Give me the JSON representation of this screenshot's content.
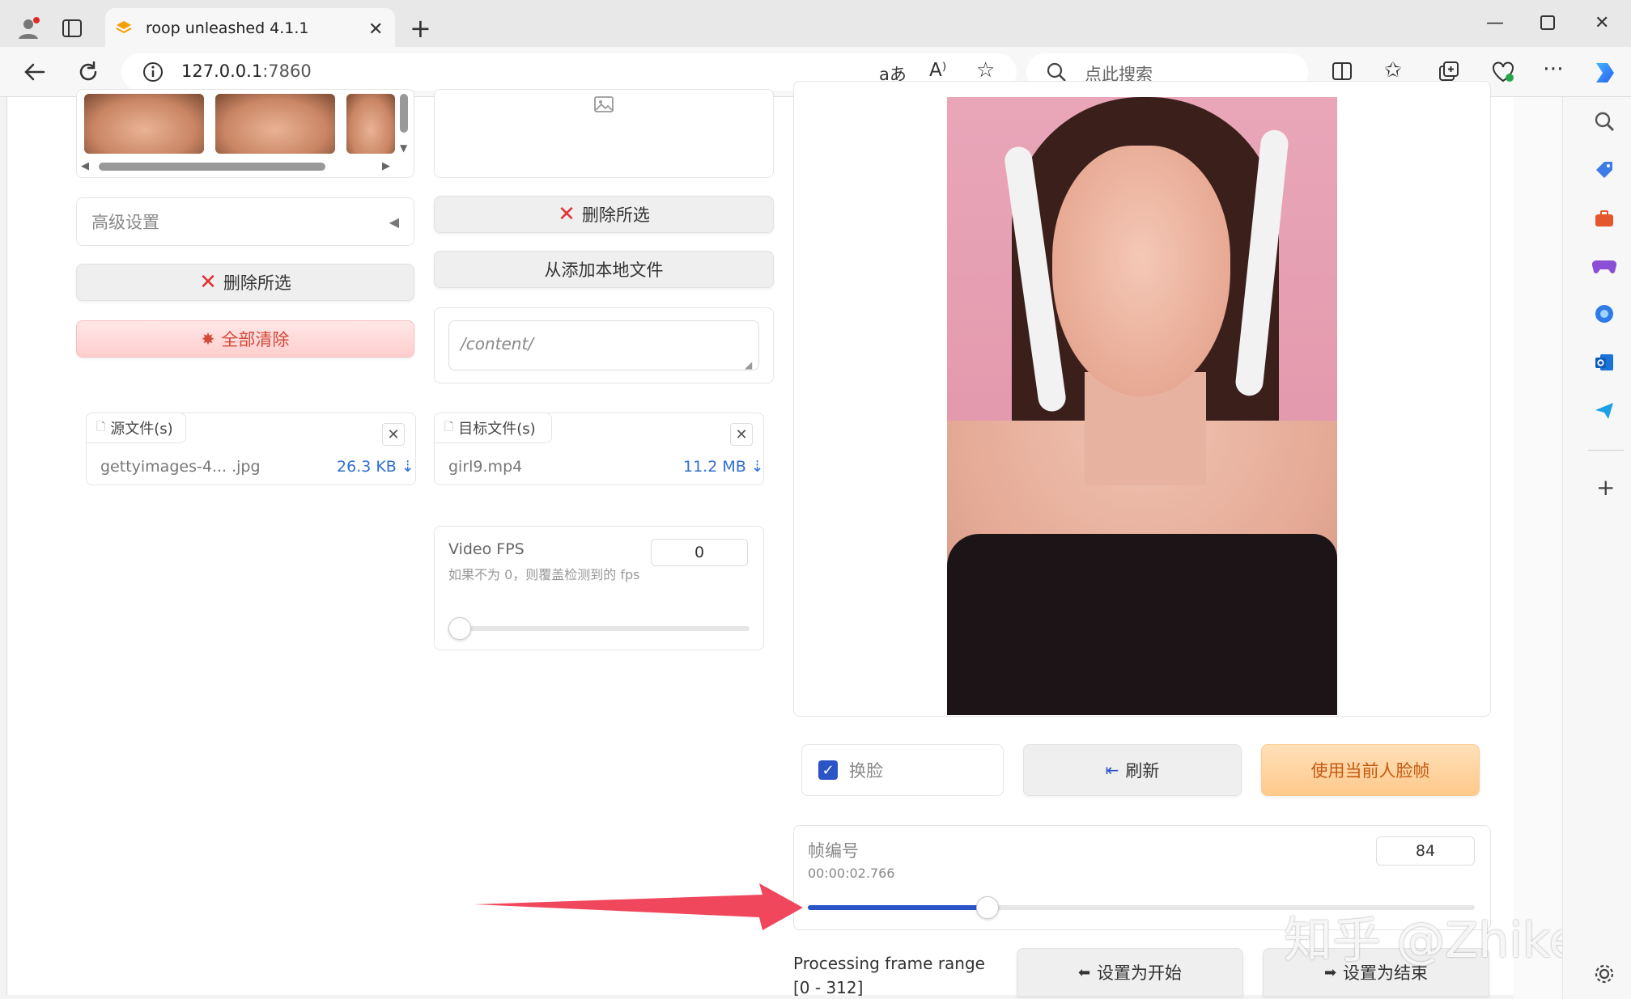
{
  "browser": {
    "tab_title": "roop unleashed 4.1.1",
    "url_host": "127.0.0.1",
    "url_port": ":7860",
    "search_placeholder": "点此搜索",
    "new_tab": "+",
    "reader_label": "aあ",
    "read_aloud_label": "A⁾"
  },
  "left": {
    "advanced_settings": "高级设置",
    "delete_selected": "删除所选",
    "clear_all": "全部清除",
    "source_tag": "源文件(s)",
    "source_file_name": "gettyimages-4... .jpg",
    "source_file_size": "26.3 KB ⇣"
  },
  "middle": {
    "delete_selected": "删除所选",
    "add_local_file": "从添加本地文件",
    "path_value": "/content/",
    "target_tag": "目标文件(s)",
    "target_file_name": "girl9.mp4",
    "target_file_size": "11.2 MB ⇣",
    "fps_label": "Video FPS",
    "fps_desc": "如果不为 0，则覆盖检测到的 fps",
    "fps_value": "0",
    "fps_slider_fraction": 0
  },
  "right": {
    "swap_face_label": "换脸",
    "swap_face_checked": true,
    "refresh_label": "刷新",
    "use_current_face_label": "使用当前人脸帧",
    "frame_label": "帧编号",
    "frame_time": "00:00:02.766",
    "frame_value": "84",
    "frame_slider_fraction": 0.27,
    "range_label": "Processing frame range [0 - 312]",
    "set_start": "设置为开始",
    "set_end": "设置为结束"
  },
  "watermark": "知乎 @Zhikes",
  "colors": {
    "accent_blue": "#2b54c7",
    "arrow_red": "#f0475d"
  }
}
